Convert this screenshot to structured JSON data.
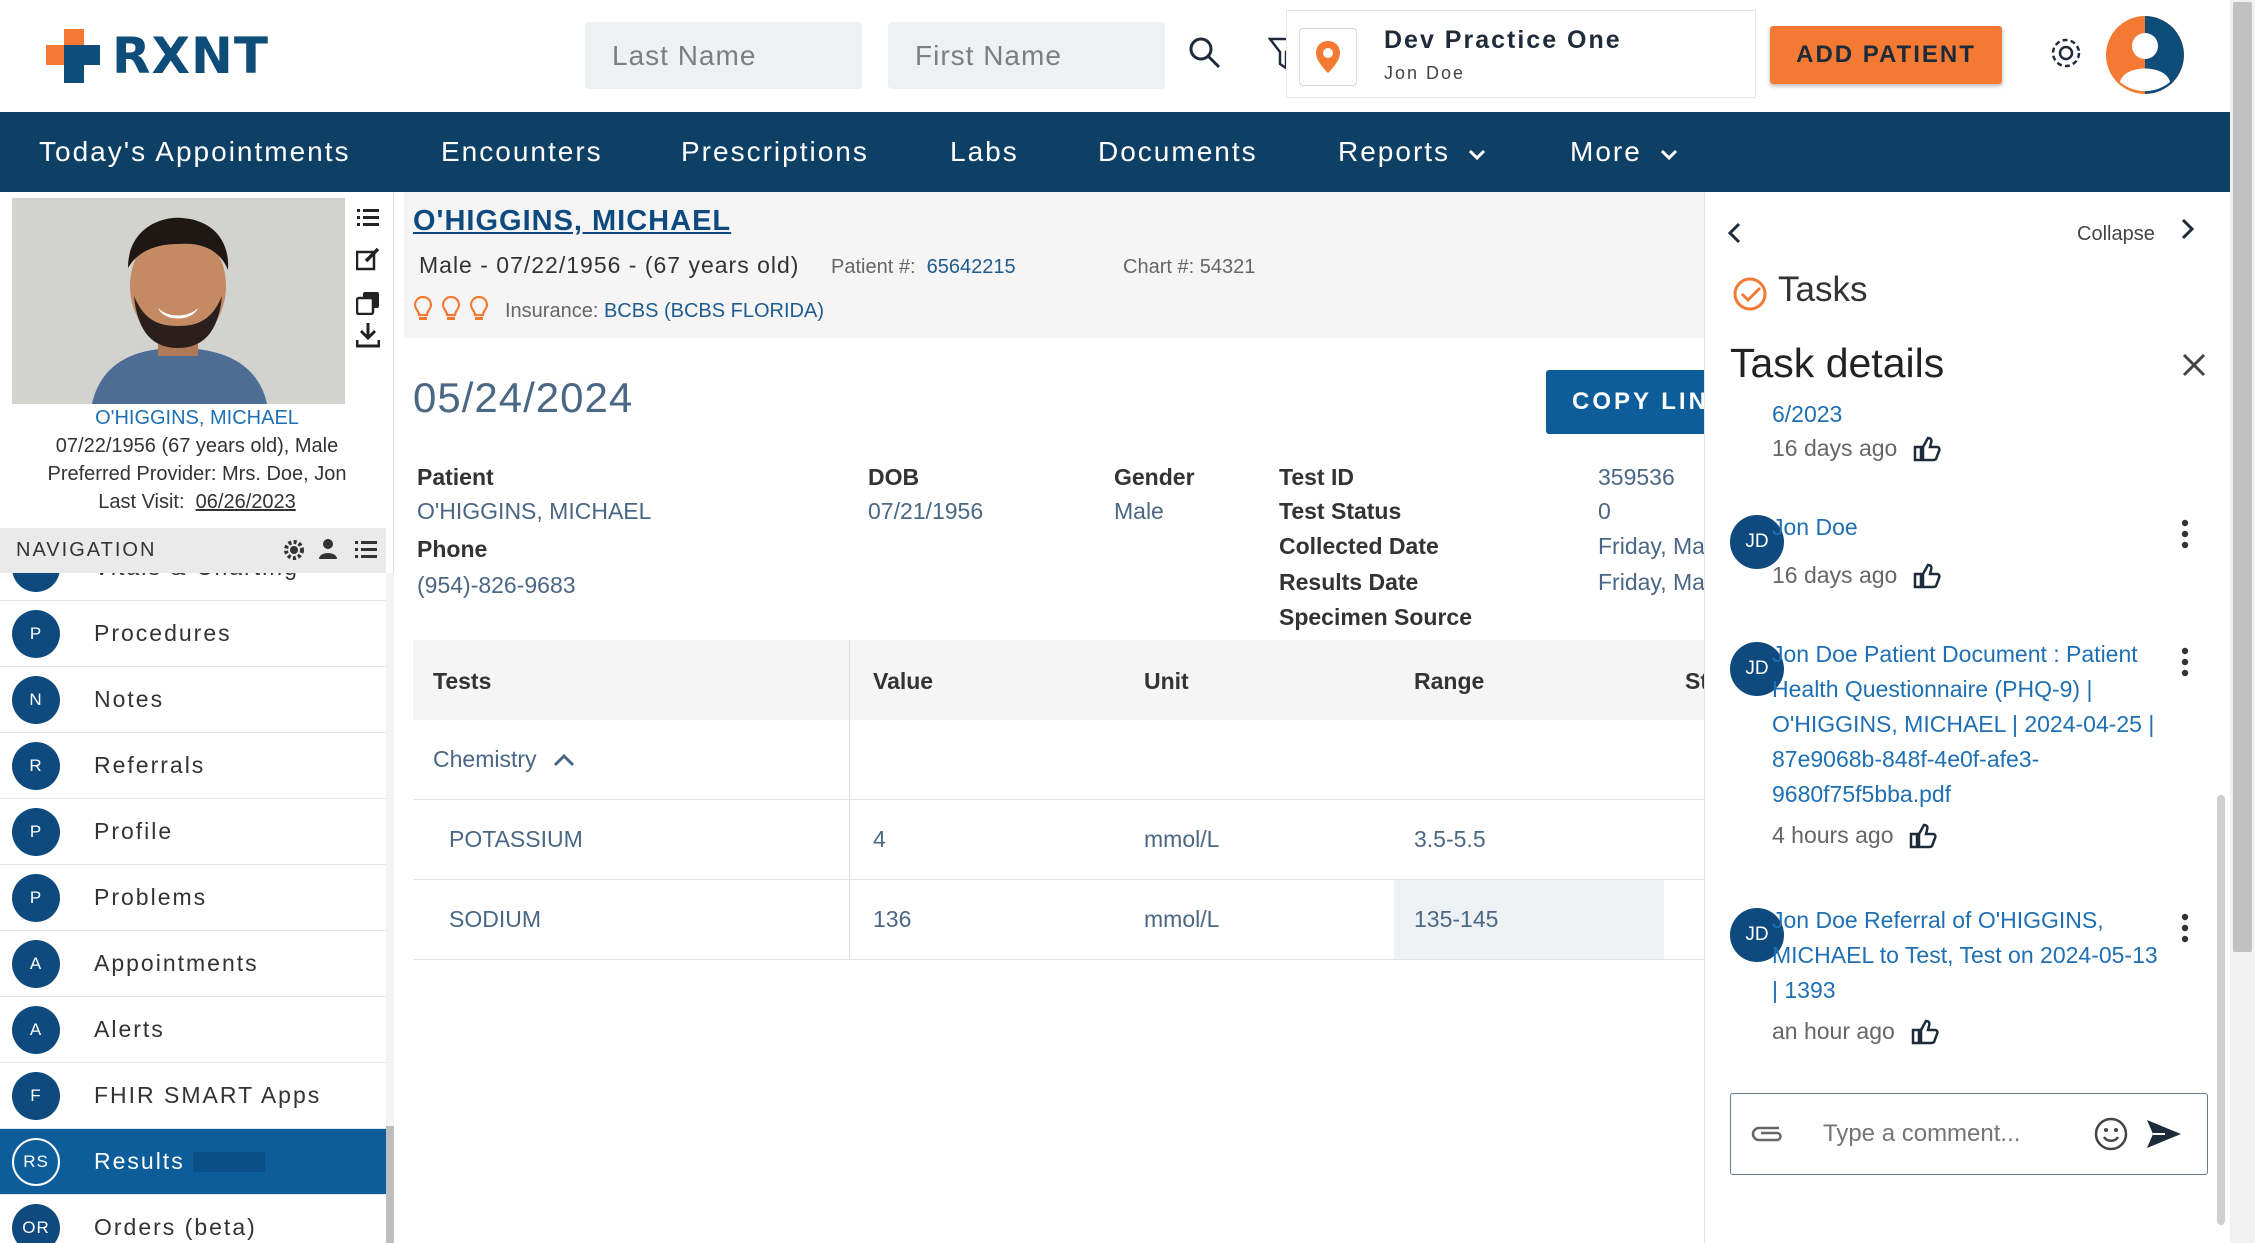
{
  "header": {
    "logo_text": "RXNT",
    "last_name_placeholder": "Last Name",
    "first_name_placeholder": "First Name",
    "practice_name": "Dev Practice One",
    "practice_user": "Jon Doe",
    "add_patient_label": "ADD PATIENT",
    "accent_color": "#f47a33",
    "brand_color": "#0e4066"
  },
  "nav": {
    "items": [
      "Today's Appointments",
      "Encounters",
      "Prescriptions",
      "Labs",
      "Documents",
      "Reports",
      "More"
    ]
  },
  "patient_card": {
    "name": "O'HIGGINS, MICHAEL",
    "dob_line": "07/22/1956 (67 years old), Male",
    "provider_line": "Preferred Provider: Mrs. Doe, Jon",
    "last_visit_label": "Last Visit:",
    "last_visit": "06/26/2023"
  },
  "navigation": {
    "header": "NAVIGATION",
    "items": [
      {
        "abbr": "V",
        "label": "Vitals & Charting"
      },
      {
        "abbr": "P",
        "label": "Procedures"
      },
      {
        "abbr": "N",
        "label": "Notes"
      },
      {
        "abbr": "R",
        "label": "Referrals"
      },
      {
        "abbr": "P",
        "label": "Profile"
      },
      {
        "abbr": "P",
        "label": "Problems"
      },
      {
        "abbr": "A",
        "label": "Appointments"
      },
      {
        "abbr": "A",
        "label": "Alerts"
      },
      {
        "abbr": "F",
        "label": "FHIR SMART Apps"
      },
      {
        "abbr": "RS",
        "label": "Results"
      },
      {
        "abbr": "OR",
        "label": "Orders (beta)"
      }
    ],
    "active": "Results"
  },
  "patient_header": {
    "name": "O'HIGGINS, MICHAEL",
    "demographics": "Male - 07/22/1956 - (67 years old)",
    "patient_num_label": "Patient #:",
    "patient_num": "65642215",
    "chart_num_label": "Chart #:",
    "chart_num": "54321",
    "insurance_label": "Insurance:",
    "insurance": "BCBS (BCBS FLORIDA)"
  },
  "result": {
    "date": "05/24/2024",
    "copy_link_label": "COPY LINK",
    "patient_label": "Patient",
    "patient": "O'HIGGINS, MICHAEL",
    "phone_label": "Phone",
    "phone": "(954)-826-9683",
    "dob_label": "DOB",
    "dob": "07/21/1956",
    "gender_label": "Gender",
    "gender": "Male",
    "test_id_label": "Test ID",
    "test_id": "359536",
    "test_status_label": "Test Status",
    "test_status": "0",
    "collected_label": "Collected Date",
    "collected": "Friday, Ma",
    "results_date_label": "Results Date",
    "results_date": "Friday, Ma",
    "specimen_label": "Specimen Source"
  },
  "table": {
    "headers": [
      "Tests",
      "Value",
      "Unit",
      "Range",
      "St"
    ],
    "group": "Chemistry",
    "rows": [
      {
        "test": "POTASSIUM",
        "value": "4",
        "unit": "mmol/L",
        "range": "3.5-5.5"
      },
      {
        "test": "SODIUM",
        "value": "136",
        "unit": "mmol/L",
        "range": "135-145"
      }
    ]
  },
  "tasks": {
    "collapse_label": "Collapse",
    "title": "Tasks",
    "details_title": "Task details",
    "feed": [
      {
        "text": "6/2023",
        "ago": "16 days ago"
      },
      {
        "initials": "JD",
        "text": "Jon Doe",
        "ago": "16 days ago"
      },
      {
        "initials": "JD",
        "text": "Jon Doe Patient Document : Patient Health Questionnaire (PHQ-9) | O'HIGGINS, MICHAEL | 2024-04-25 | 87e9068b-848f-4e0f-afe3-9680f75f5bba.pdf",
        "ago": "4 hours ago"
      },
      {
        "initials": "JD",
        "text": "Jon Doe Referral of O'HIGGINS, MICHAEL to Test, Test on 2024-05-13 | 1393",
        "ago": "an hour ago"
      }
    ],
    "comment_placeholder": "Type a comment..."
  }
}
